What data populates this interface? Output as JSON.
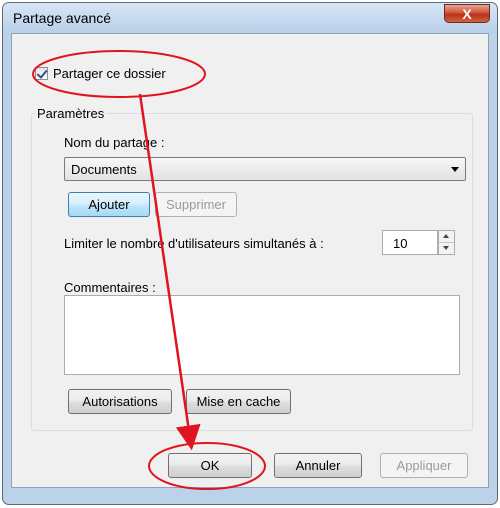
{
  "window": {
    "title": "Partage avancé",
    "close_label": "X"
  },
  "share_checkbox": {
    "label": "Partager ce dossier",
    "checked": true
  },
  "parameters": {
    "group_label": "Paramètres",
    "share_name_label": "Nom du partage :",
    "share_name_value": "Documents",
    "add_button": "Ajouter",
    "remove_button": "Supprimer",
    "limit_label": "Limiter le nombre d'utilisateurs simultanés à :",
    "limit_value": "10",
    "comments_label": "Commentaires :",
    "comments_value": "",
    "permissions_button": "Autorisations",
    "caching_button": "Mise en cache"
  },
  "footer": {
    "ok_button": "OK",
    "cancel_button": "Annuler",
    "apply_button": "Appliquer"
  },
  "annotation": {
    "color": "#e0141e"
  }
}
